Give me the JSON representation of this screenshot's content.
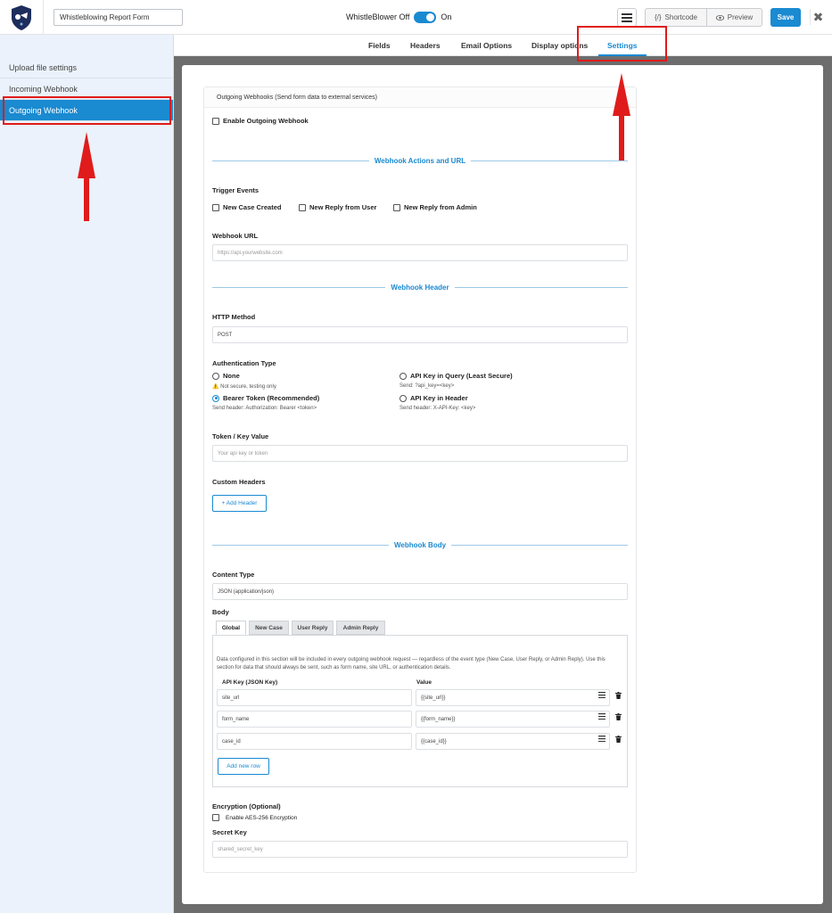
{
  "topbar": {
    "form_name": "Whistleblowing Report Form",
    "toggle_off_label": "WhistleBlower Off",
    "toggle_on_label": "On",
    "shortcode_label": "Shortcode",
    "shortcode_icon_text": "{/}",
    "preview_label": "Preview",
    "save_label": "Save",
    "close_symbol": "✖"
  },
  "tabs": [
    {
      "label": "Fields"
    },
    {
      "label": "Headers"
    },
    {
      "label": "Email Options"
    },
    {
      "label": "Display options"
    },
    {
      "label": "Settings"
    }
  ],
  "sidebar": {
    "items": [
      {
        "label": "Upload file settings"
      },
      {
        "label": "Incoming Webhook"
      },
      {
        "label": "Outgoing Webhook"
      }
    ]
  },
  "card": {
    "header": "Outgoing Webhooks (Send form data to external services)",
    "enable_label": "Enable Outgoing Webhook",
    "section_actions": "Webhook Actions and URL",
    "trigger_events_label": "Trigger Events",
    "triggers": [
      {
        "label": "New Case Created"
      },
      {
        "label": "New Reply from User"
      },
      {
        "label": "New Reply from Admin"
      }
    ],
    "webhook_url_label": "Webhook URL",
    "webhook_url_placeholder": "https://api.yourwebsite.com",
    "section_header": "Webhook Header",
    "http_method_label": "HTTP Method",
    "http_method_value": "POST",
    "auth_type_label": "Authentication Type",
    "auth_options": [
      {
        "label": "None",
        "hint": "⚠️ Not secure, testing only"
      },
      {
        "label": "API Key in Query (Least Secure)",
        "hint": "Send: ?api_key=<key>"
      },
      {
        "label": "Bearer Token (Recommended)",
        "hint": "Send header: Authorization: Bearer <token>"
      },
      {
        "label": "API Key in Header",
        "hint": "Send header: X-API-Key: <key>"
      }
    ],
    "token_label": "Token / Key Value",
    "token_placeholder": "Your api key or token",
    "custom_headers_label": "Custom Headers",
    "add_header_label": "+ Add Header",
    "section_body": "Webhook Body",
    "content_type_label": "Content Type",
    "content_type_value": "JSON (application/json)",
    "body_label": "Body",
    "body_tabs": [
      {
        "label": "Global"
      },
      {
        "label": "New Case"
      },
      {
        "label": "User Reply"
      },
      {
        "label": "Admin Reply"
      }
    ],
    "body_description": "Data configured in this section will be included in every outgoing webhook request — regardless of the event type (New Case, User Reply, or Admin Reply). Use this section for data that should always be sent, such as form name, site URL, or authentication details.",
    "col_key": "API Key (JSON Key)",
    "col_value": "Value",
    "rows": [
      {
        "key": "site_url",
        "value": "{{site_url}}"
      },
      {
        "key": "form_name",
        "value": "{{form_name}}"
      },
      {
        "key": "case_id",
        "value": "{{case_id}}"
      }
    ],
    "add_row_label": "Add new row",
    "encryption_label": "Encryption (Optional)",
    "encryption_option": "Enable AES-256 Encryption",
    "secret_key_label": "Secret Key",
    "secret_key_placeholder": "shared_secret_key"
  },
  "colors": {
    "accent": "#1a8ad1",
    "annotation": "#e01b1b",
    "sidebar_bg": "#ebf2fb",
    "canvas_bg": "#6d6d6d"
  }
}
